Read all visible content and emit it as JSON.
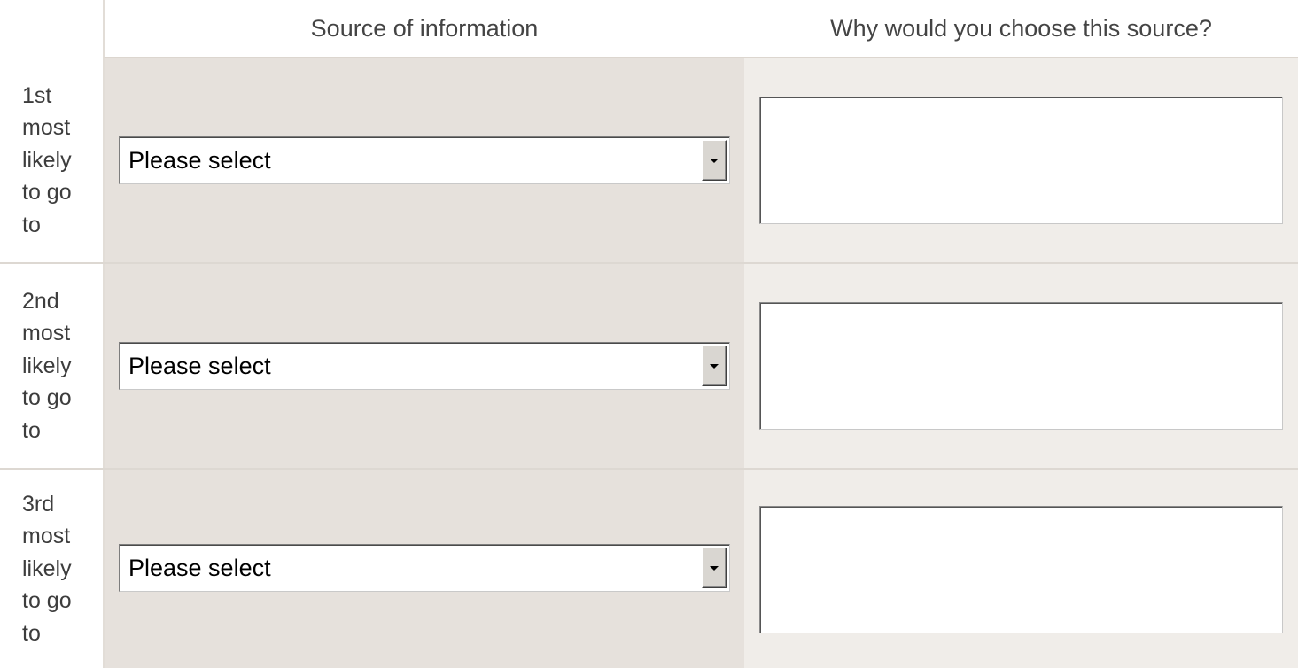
{
  "table": {
    "headers": {
      "blank": "",
      "source": "Source of information",
      "why": "Why would you choose this source?"
    },
    "rows": [
      {
        "label": "1st most likely to go to",
        "select_value": "Please select",
        "reason_value": ""
      },
      {
        "label": "2nd most likely to go to",
        "select_value": "Please select",
        "reason_value": ""
      },
      {
        "label": "3rd most likely to go to",
        "select_value": "Please select",
        "reason_value": ""
      }
    ]
  },
  "icons": {
    "dropdown": "chevron-down-icon"
  },
  "colors": {
    "source_column_bg": "#e6e1dc",
    "why_column_bg": "#f0ede9",
    "row_separator": "#ddd8d2",
    "text": "#3d3d3d"
  }
}
